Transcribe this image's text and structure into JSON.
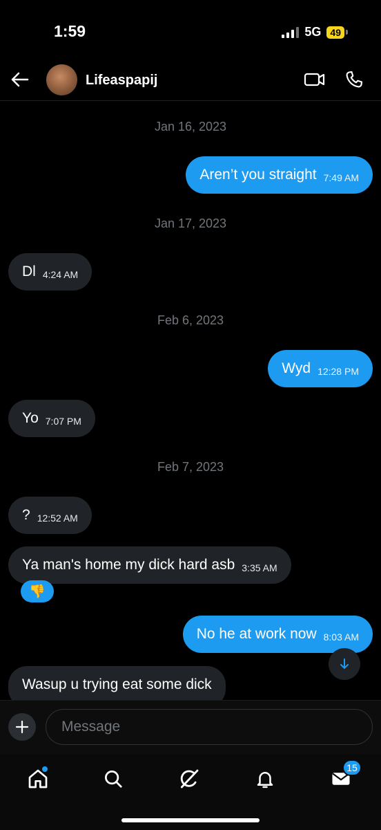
{
  "status_bar": {
    "time": "1:59",
    "network": "5G",
    "battery": "49"
  },
  "header": {
    "contact_name": "Lifeaspapij"
  },
  "messages": [
    {
      "type": "date",
      "text": "Jan 16, 2023"
    },
    {
      "type": "outgoing",
      "text": "Aren’t you straight",
      "time": "7:49 AM"
    },
    {
      "type": "date",
      "text": "Jan 17, 2023"
    },
    {
      "type": "incoming",
      "text": "Dl",
      "time": "4:24 AM"
    },
    {
      "type": "date",
      "text": "Feb 6, 2023"
    },
    {
      "type": "outgoing",
      "text": "Wyd",
      "time": "12:28 PM"
    },
    {
      "type": "incoming",
      "text": "Yo",
      "time": "7:07 PM"
    },
    {
      "type": "date",
      "text": "Feb 7, 2023"
    },
    {
      "type": "incoming",
      "text": "?",
      "time": "12:52 AM"
    },
    {
      "type": "incoming",
      "text": "Ya man's home my dick hard asb",
      "time": "3:35 AM",
      "reaction": "👎"
    },
    {
      "type": "outgoing",
      "text": "No he at work now",
      "time": "8:03 AM"
    },
    {
      "type": "incoming",
      "text": "Wasup u trying eat some dick",
      "time": ""
    }
  ],
  "composer": {
    "placeholder": "Message"
  },
  "tab_bar": {
    "items": [
      {
        "name": "home",
        "icon": "home-icon",
        "active": true
      },
      {
        "name": "search",
        "icon": "search-icon"
      },
      {
        "name": "grok",
        "icon": "grok-icon"
      },
      {
        "name": "notifications",
        "icon": "bell-icon"
      },
      {
        "name": "messages",
        "icon": "mail-icon"
      }
    ],
    "messages_badge": "15"
  },
  "colors": {
    "accent": "#1d9bf0",
    "incoming_bubble": "#202327",
    "background": "#000000",
    "muted_text": "#71767b"
  }
}
